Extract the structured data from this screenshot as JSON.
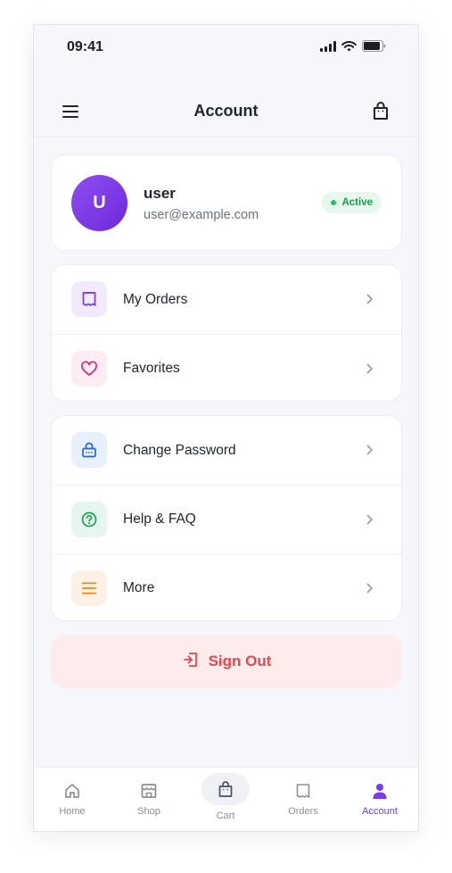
{
  "status": {
    "time": "09:41"
  },
  "appbar": {
    "title": "Account"
  },
  "profile": {
    "initial": "U",
    "name": "user",
    "email": "user@example.com",
    "status": "Active"
  },
  "menu": {
    "orders": "My Orders",
    "favorites": "Favorites",
    "change_password": "Change Password",
    "help": "Help & FAQ",
    "more": "More"
  },
  "signout": {
    "label": "Sign Out"
  },
  "tabs": {
    "home": "Home",
    "shop": "Shop",
    "cart": "Cart",
    "orders": "Orders",
    "account": "Account"
  },
  "colors": {
    "accent": "#7c3aed",
    "danger": "#e5484d",
    "success": "#16a34a"
  }
}
